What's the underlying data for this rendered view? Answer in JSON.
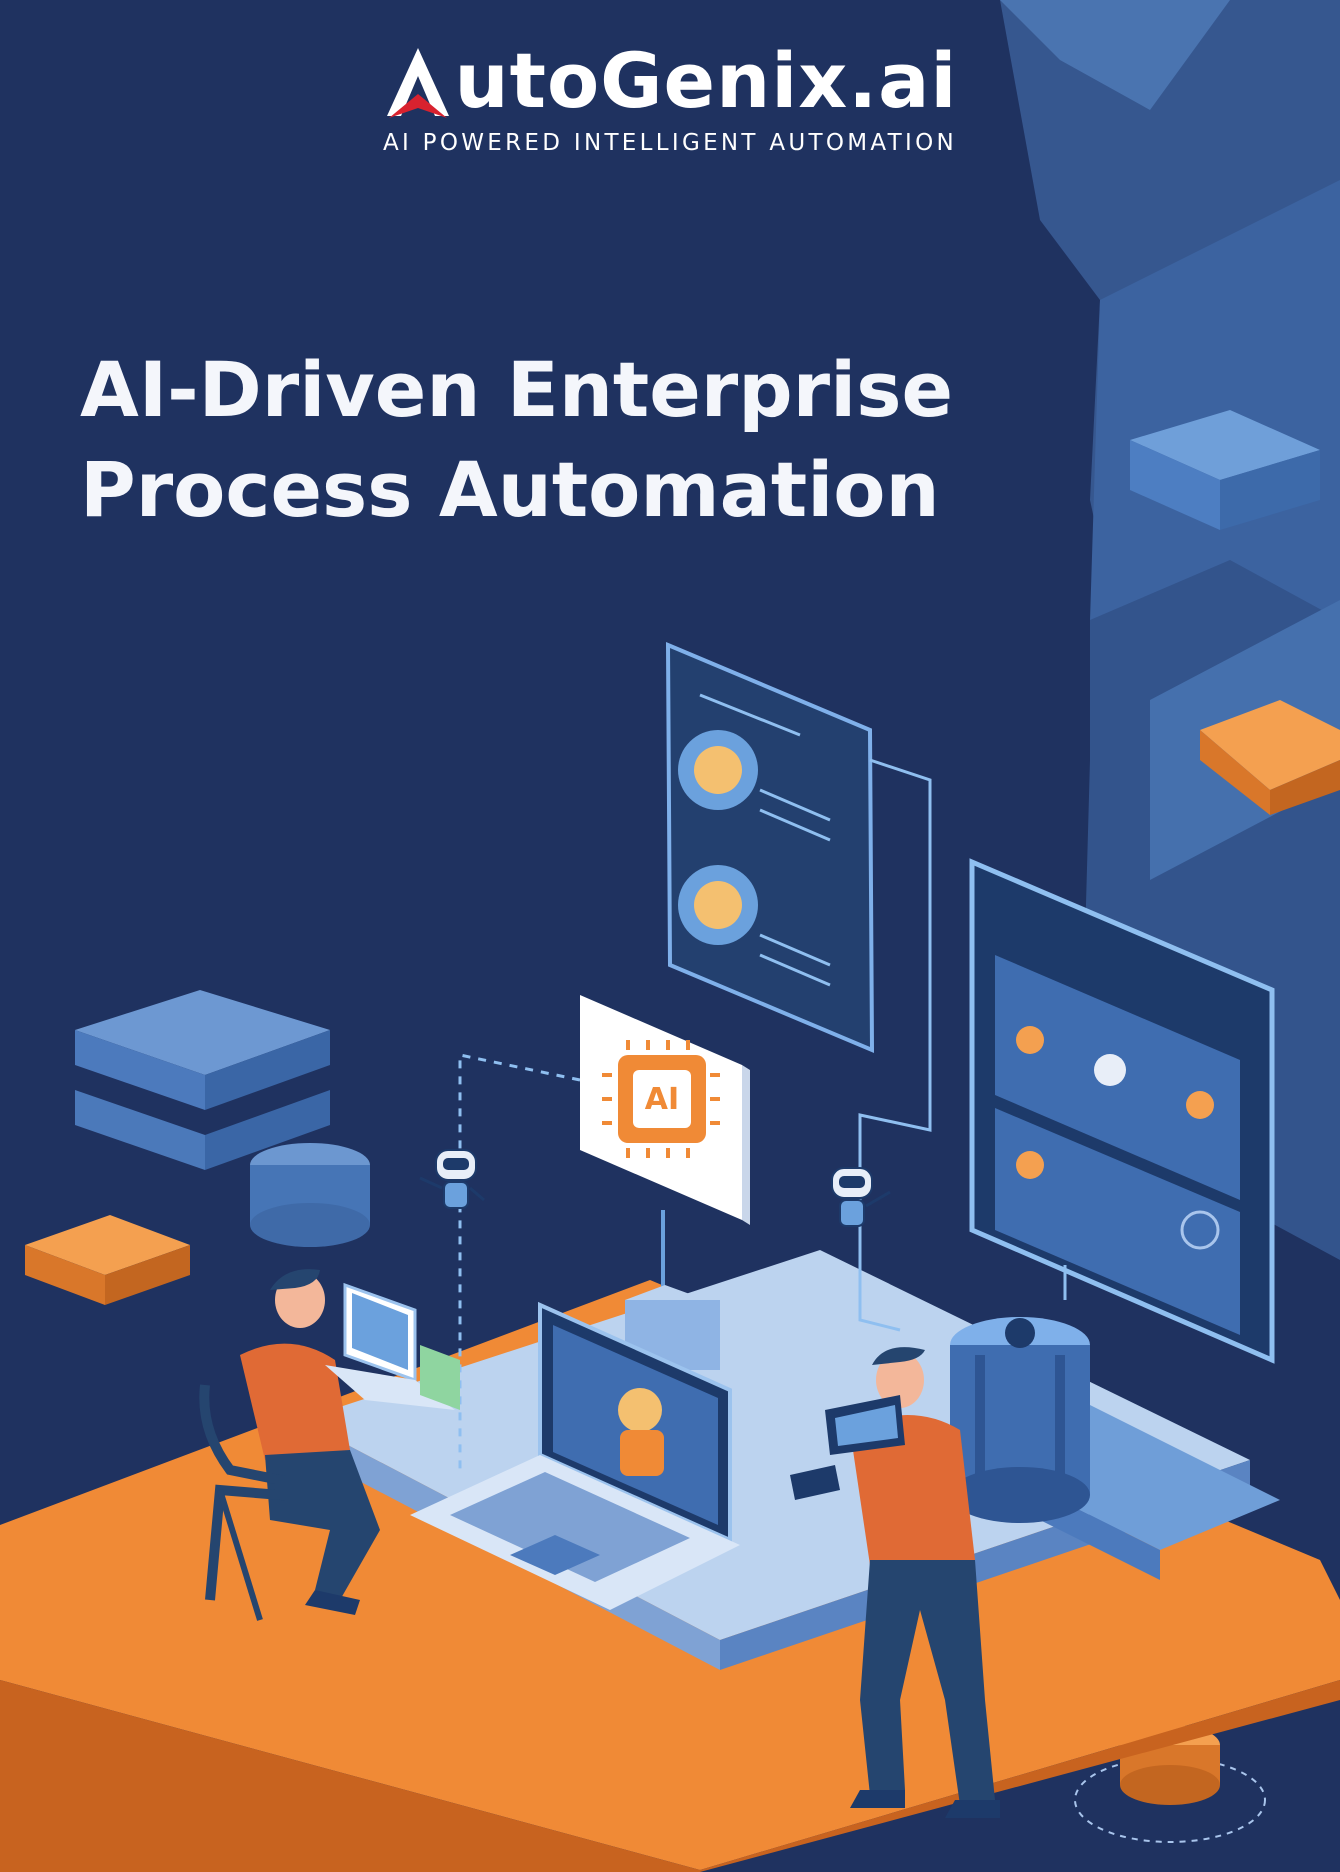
{
  "brand": {
    "name": "utoGenix.ai",
    "tagline": "AI POWERED INTELLIGENT AUTOMATION"
  },
  "headline": {
    "line1": "AI-Driven Enterprise",
    "line2": "Process Automation"
  },
  "chip_label": "AI",
  "colors": {
    "background": "#1f3260",
    "accent": "#f08a36",
    "panel": "#3f6db0",
    "light": "#a9c5ec",
    "logo_red": "#d8222f"
  }
}
